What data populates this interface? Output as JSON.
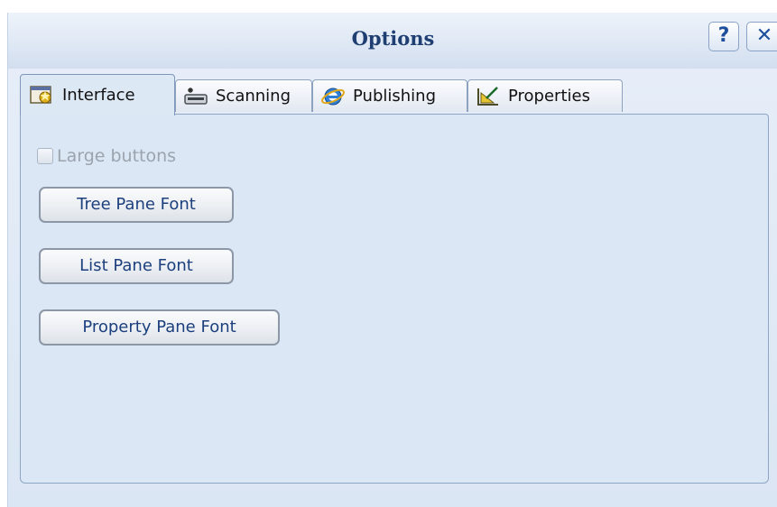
{
  "window": {
    "title": "Options",
    "help_label": "?",
    "close_label": "✕"
  },
  "tabs": [
    {
      "label": "Interface",
      "icon": "interface-icon",
      "active": true
    },
    {
      "label": "Scanning",
      "icon": "scanner-icon",
      "active": false
    },
    {
      "label": "Publishing",
      "icon": "ie-globe-icon",
      "active": false
    },
    {
      "label": "Properties",
      "icon": "properties-icon",
      "active": false
    }
  ],
  "interface_panel": {
    "large_buttons": {
      "label": "Large buttons",
      "checked": false,
      "enabled": false
    },
    "buttons": {
      "tree": "Tree Pane Font",
      "list": "List Pane Font",
      "property": "Property Pane Font"
    }
  },
  "colors": {
    "title_text": "#1f3f73",
    "panel_bg": "#dce7f5",
    "button_text": "#1c3f7d"
  }
}
